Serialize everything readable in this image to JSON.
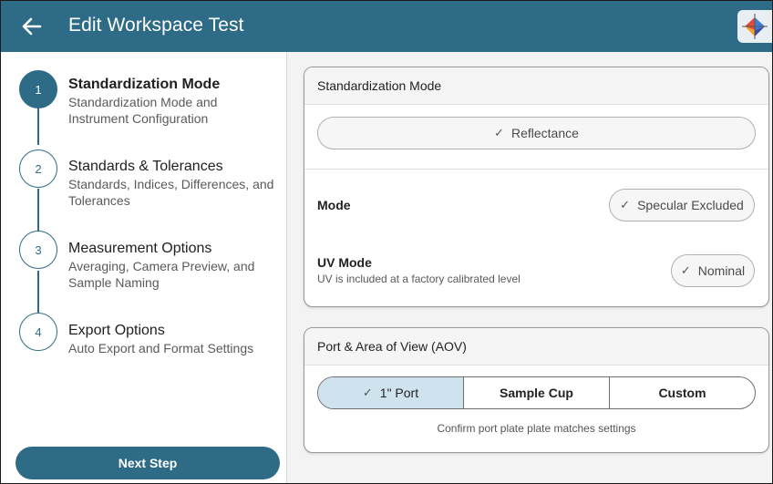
{
  "header": {
    "title": "Edit Workspace Test",
    "back_icon": "arrow-left-icon",
    "brand_icon": "color-brand-icon",
    "colors": {
      "header_bg": "#2e6b86",
      "accent": "#2e6b86"
    }
  },
  "steps": [
    {
      "number": "1",
      "title": "Standardization Mode",
      "subtitle": "Standardization Mode and Instrument Configuration",
      "active": true
    },
    {
      "number": "2",
      "title": "Standards & Tolerances",
      "subtitle": "Standards, Indices, Differences, and Tolerances",
      "active": false
    },
    {
      "number": "3",
      "title": "Measurement Options",
      "subtitle": "Averaging, Camera Preview, and Sample Naming",
      "active": false
    },
    {
      "number": "4",
      "title": "Export Options",
      "subtitle": "Auto Export and Format Settings",
      "active": false
    }
  ],
  "next_button": "Next Step",
  "standardization_card": {
    "header": "Standardization Mode",
    "selected_mode": "Reflectance",
    "mode": {
      "label": "Mode",
      "value": "Specular Excluded"
    },
    "uv_mode": {
      "label": "UV Mode",
      "sublabel": "UV is included at a factory calibrated level",
      "value": "Nominal"
    }
  },
  "port_card": {
    "header": "Port & Area of View (AOV)",
    "options": [
      "1\" Port",
      "Sample Cup",
      "Custom"
    ],
    "selected": "1\" Port",
    "note": "Confirm port plate plate matches settings"
  }
}
